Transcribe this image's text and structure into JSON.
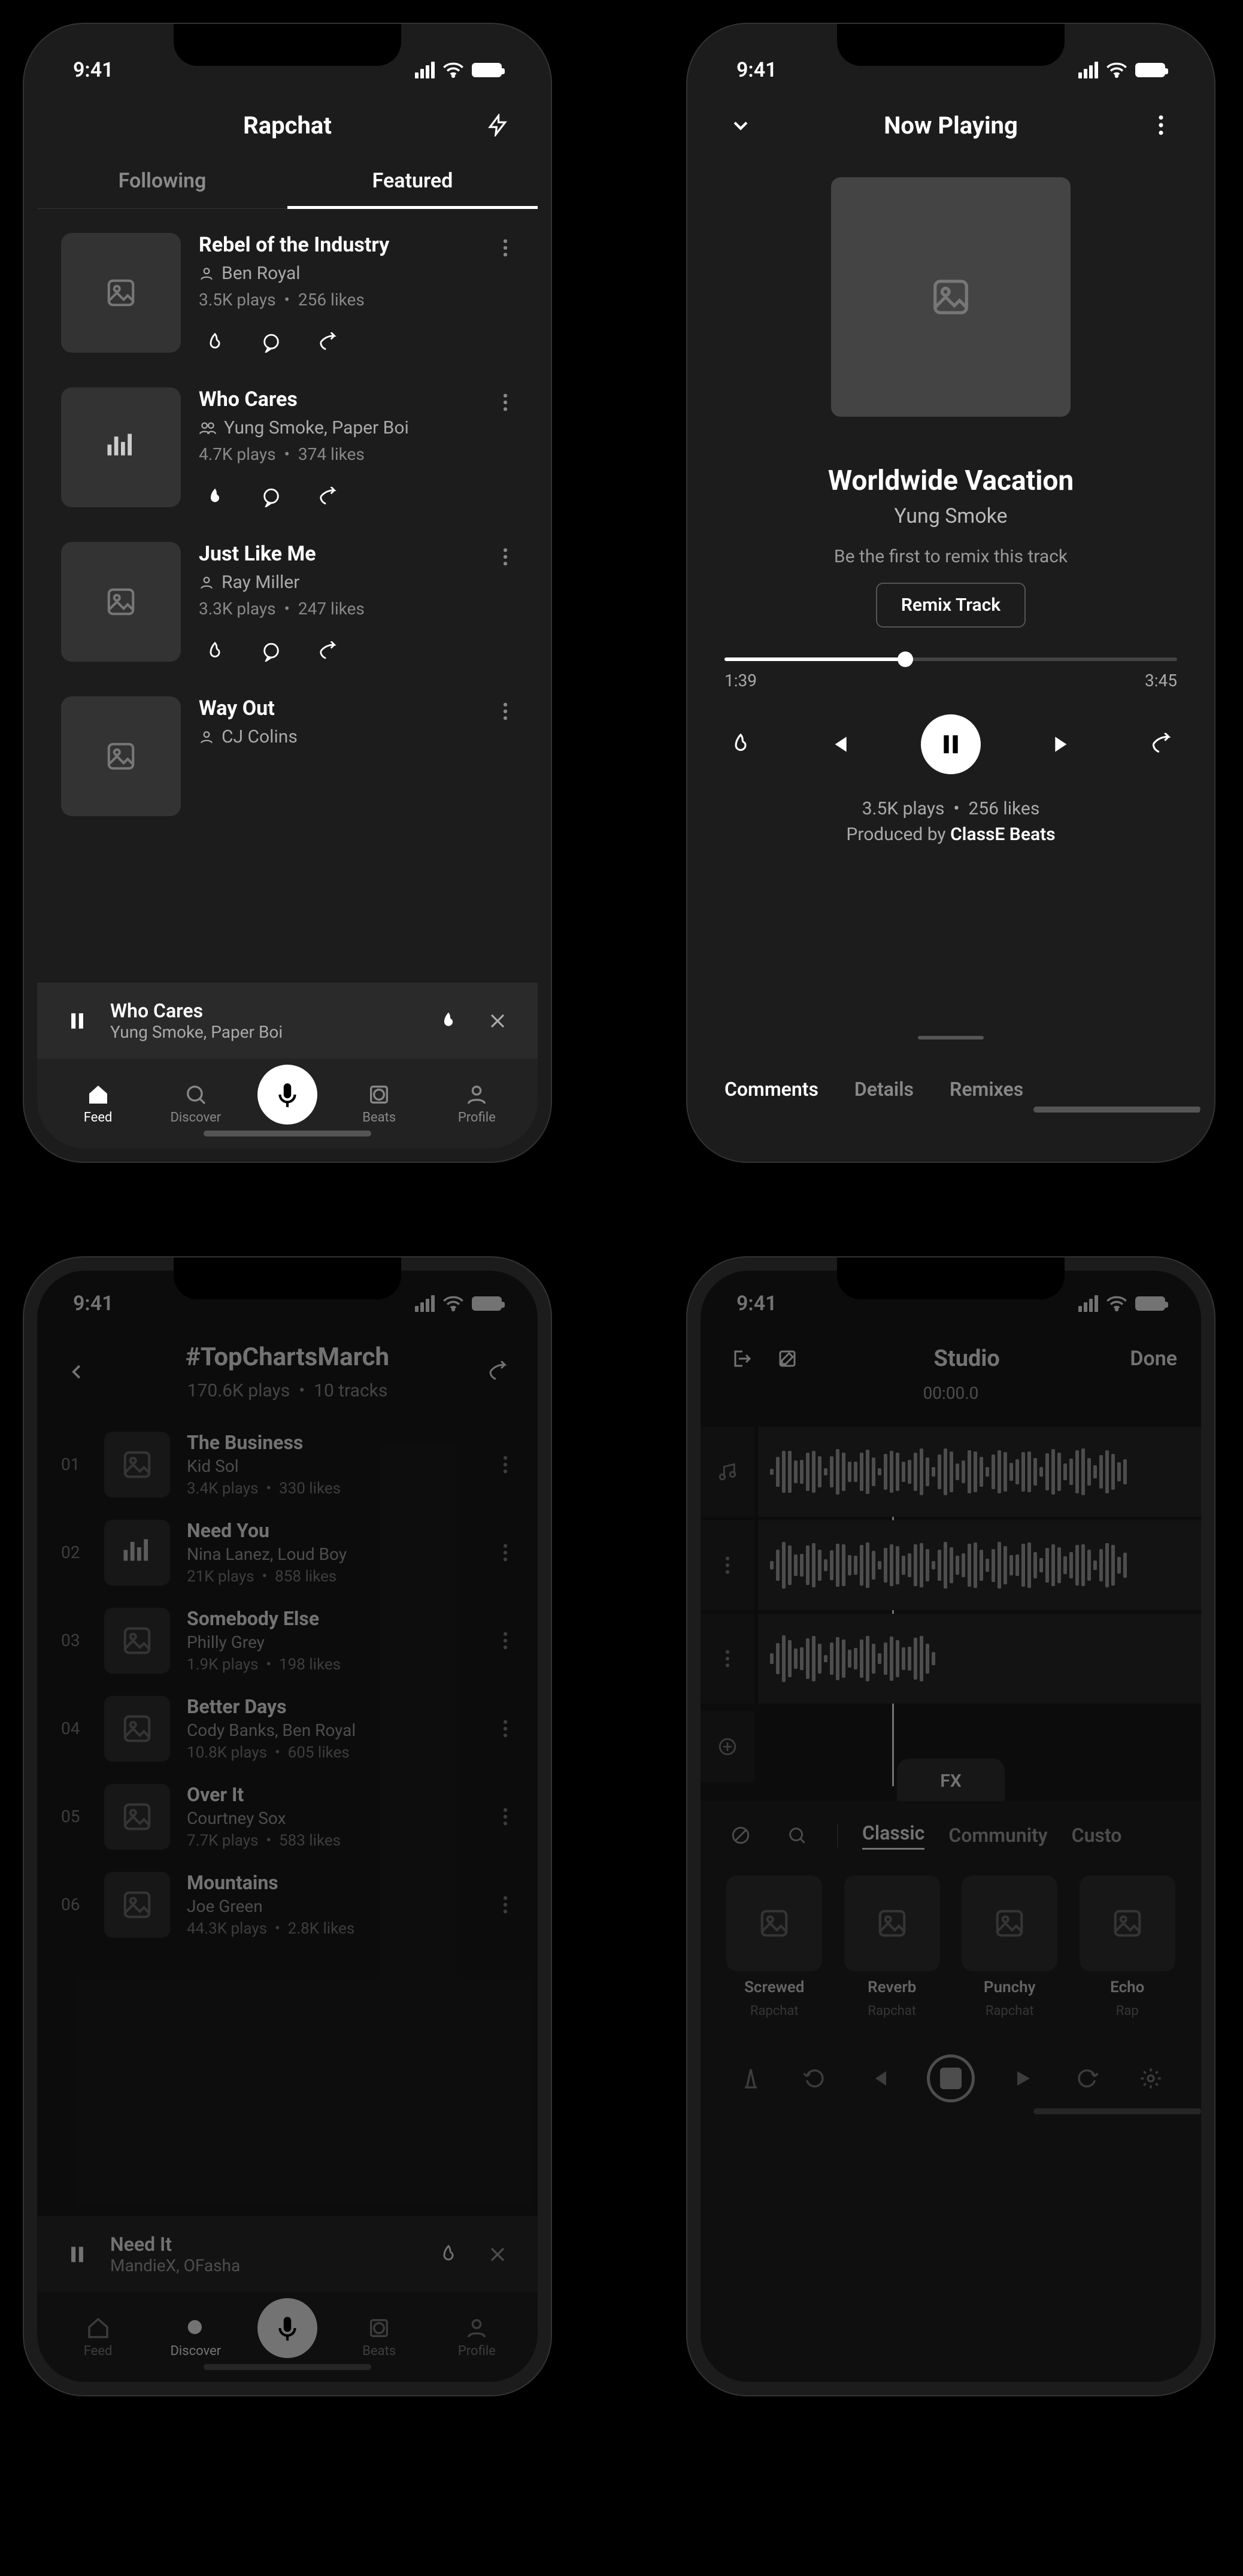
{
  "status": {
    "time": "9:41"
  },
  "screen1": {
    "title": "Rapchat",
    "tabs": {
      "following": "Following",
      "featured": "Featured"
    },
    "feed": [
      {
        "title": "Rebel of the Industry",
        "artist": "Ben Royal",
        "plays": "3.5K plays",
        "likes": "256 likes",
        "multi": false,
        "thumb": "image"
      },
      {
        "title": "Who Cares",
        "artist": "Yung Smoke, Paper Boi",
        "plays": "4.7K plays",
        "likes": "374 likes",
        "multi": true,
        "thumb": "bars"
      },
      {
        "title": "Just Like Me",
        "artist": "Ray Miller",
        "plays": "3.3K plays",
        "likes": "247 likes",
        "multi": false,
        "thumb": "image"
      },
      {
        "title": "Way Out",
        "artist": "CJ Colins",
        "plays": "",
        "likes": "",
        "multi": false,
        "thumb": "image"
      }
    ],
    "miniplayer": {
      "title": "Who Cares",
      "artist": "Yung Smoke, Paper Boi"
    },
    "nav": {
      "feed": "Feed",
      "discover": "Discover",
      "beats": "Beats",
      "profile": "Profile"
    }
  },
  "screen2": {
    "header": "Now Playing",
    "title": "Worldwide Vacation",
    "artist": "Yung Smoke",
    "sub": "Be the first to remix this track",
    "remix": "Remix Track",
    "elapsed": "1:39",
    "duration": "3:45",
    "stats_plays": "3.5K plays",
    "stats_likes": "256 likes",
    "produced_label": "Produced by ",
    "produced_by": "ClassE Beats",
    "tabs": {
      "comments": "Comments",
      "details": "Details",
      "remixes": "Remixes"
    }
  },
  "screen3": {
    "title": "#TopChartsMarch",
    "plays": "170.6K plays",
    "tracks_count": "10 tracks",
    "list": [
      {
        "n": "01",
        "title": "The Business",
        "artist": "Kid Sol",
        "plays": "3.4K plays",
        "likes": "330 likes",
        "thumb": "image"
      },
      {
        "n": "02",
        "title": "Need You",
        "artist": "Nina Lanez, Loud Boy",
        "plays": "21K plays",
        "likes": "858 likes",
        "thumb": "bars"
      },
      {
        "n": "03",
        "title": "Somebody Else",
        "artist": "Philly Grey",
        "plays": "1.9K plays",
        "likes": "198 likes",
        "thumb": "image"
      },
      {
        "n": "04",
        "title": "Better Days",
        "artist": "Cody Banks, Ben Royal",
        "plays": "10.8K plays",
        "likes": "605 likes",
        "thumb": "image"
      },
      {
        "n": "05",
        "title": "Over It",
        "artist": "Courtney Sox",
        "plays": "7.7K plays",
        "likes": "583 likes",
        "thumb": "image"
      },
      {
        "n": "06",
        "title": "Mountains",
        "artist": "Joe Green",
        "plays": "44.3K plays",
        "likes": "2.8K likes",
        "thumb": "image"
      }
    ],
    "miniplayer": {
      "title": "Need It",
      "artist": "MandieX, OFasha"
    }
  },
  "screen4": {
    "title": "Studio",
    "done": "Done",
    "time": "00:00.0",
    "fx_label": "FX",
    "fx_cats": {
      "classic": "Classic",
      "community": "Community",
      "custom": "Custo"
    },
    "fx": [
      {
        "name": "Screwed",
        "src": "Rapchat"
      },
      {
        "name": "Reverb",
        "src": "Rapchat"
      },
      {
        "name": "Punchy",
        "src": "Rapchat"
      },
      {
        "name": "Echo",
        "src": "Rap"
      }
    ]
  }
}
